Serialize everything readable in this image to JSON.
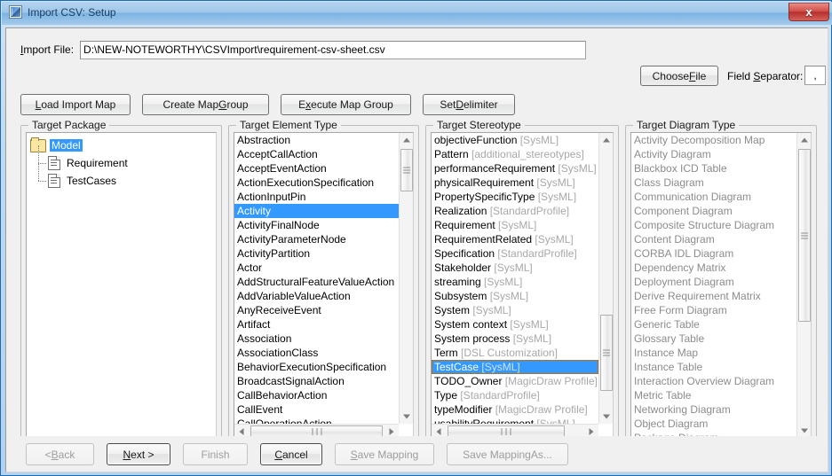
{
  "window": {
    "title": "Import CSV: Setup",
    "app_icon": "csv-app-icon",
    "close_label": "x"
  },
  "toolbar": {
    "import_file_label": "Import File:",
    "import_file_value": "D:\\NEW-NOTEWORTHY\\CSVImport\\requirement-csv-sheet.csv",
    "import_file_placeholder": "",
    "choose_file_label": "Choose File",
    "field_separator_label": "Field Separator:",
    "field_separator_value": ",",
    "buttons": [
      {
        "label": "Load Import Map",
        "enabled": true
      },
      {
        "label": "Create Map Group",
        "enabled": true
      },
      {
        "label": "Execute Map Group",
        "enabled": true
      },
      {
        "label": "Set Delimiter",
        "enabled": true
      }
    ]
  },
  "panels": {
    "target_package": {
      "title": "Target Package",
      "tree": [
        {
          "label": "Model",
          "icon": "folder-icon",
          "level": 0,
          "selected": true
        },
        {
          "label": "Requirement",
          "icon": "document-icon",
          "level": 1,
          "selected": false
        },
        {
          "label": "TestCases",
          "icon": "document-icon",
          "level": 1,
          "selected": false
        }
      ]
    },
    "target_element_type": {
      "title": "Target Element Type",
      "items": [
        {
          "name": "Abstraction"
        },
        {
          "name": "AcceptCallAction"
        },
        {
          "name": "AcceptEventAction"
        },
        {
          "name": "ActionExecutionSpecification"
        },
        {
          "name": "ActionInputPin"
        },
        {
          "name": "Activity",
          "selected": true
        },
        {
          "name": "ActivityFinalNode"
        },
        {
          "name": "ActivityParameterNode"
        },
        {
          "name": "ActivityPartition"
        },
        {
          "name": "Actor"
        },
        {
          "name": "AddStructuralFeatureValueAction"
        },
        {
          "name": "AddVariableValueAction"
        },
        {
          "name": "AnyReceiveEvent"
        },
        {
          "name": "Artifact"
        },
        {
          "name": "Association"
        },
        {
          "name": "AssociationClass"
        },
        {
          "name": "BehaviorExecutionSpecification"
        },
        {
          "name": "BroadcastSignalAction"
        },
        {
          "name": "CallBehaviorAction"
        },
        {
          "name": "CallEvent"
        },
        {
          "name": "CallOperationAction"
        }
      ]
    },
    "target_stereotype": {
      "title": "Target Stereotype",
      "items": [
        {
          "name": "objectiveFunction",
          "profile": "[SysML]"
        },
        {
          "name": "Pattern",
          "profile": "[additional_stereotypes]"
        },
        {
          "name": "performanceRequirement",
          "profile": "[SysML]"
        },
        {
          "name": "physicalRequirement",
          "profile": "[SysML]"
        },
        {
          "name": "PropertySpecificType",
          "profile": "[SysML]"
        },
        {
          "name": "Realization",
          "profile": "[StandardProfile]"
        },
        {
          "name": "Requirement",
          "profile": "[SysML]"
        },
        {
          "name": "RequirementRelated",
          "profile": "[SysML]"
        },
        {
          "name": "Specification",
          "profile": "[StandardProfile]"
        },
        {
          "name": "Stakeholder",
          "profile": "[SysML]"
        },
        {
          "name": "streaming",
          "profile": "[SysML]"
        },
        {
          "name": "Subsystem",
          "profile": "[SysML]"
        },
        {
          "name": "System",
          "profile": "[SysML]"
        },
        {
          "name": "System context",
          "profile": "[SysML]"
        },
        {
          "name": "System process",
          "profile": "[SysML]"
        },
        {
          "name": "Term",
          "profile": "[DSL Customization]"
        },
        {
          "name": "TestCase",
          "profile": "[SysML]",
          "selected": true
        },
        {
          "name": "TODO_Owner",
          "profile": "[MagicDraw Profile]"
        },
        {
          "name": "Type",
          "profile": "[StandardProfile]"
        },
        {
          "name": "typeModifier",
          "profile": "[MagicDraw Profile]"
        },
        {
          "name": "usabilityRequirement",
          "profile": "[SysML]"
        }
      ]
    },
    "target_diagram_type": {
      "title": "Target Diagram Type",
      "enabled": false,
      "items": [
        {
          "name": "Activity Decomposition Map"
        },
        {
          "name": "Activity Diagram"
        },
        {
          "name": "Blackbox ICD Table"
        },
        {
          "name": "Class Diagram"
        },
        {
          "name": "Communication Diagram"
        },
        {
          "name": "Component Diagram"
        },
        {
          "name": "Composite Structure Diagram"
        },
        {
          "name": "Content Diagram"
        },
        {
          "name": "CORBA IDL Diagram"
        },
        {
          "name": "Dependency Matrix"
        },
        {
          "name": "Deployment Diagram"
        },
        {
          "name": "Derive Requirement Matrix"
        },
        {
          "name": "Free Form Diagram"
        },
        {
          "name": "Generic Table"
        },
        {
          "name": "Glossary Table"
        },
        {
          "name": "Instance Map"
        },
        {
          "name": "Instance Table"
        },
        {
          "name": "Interaction Overview Diagram"
        },
        {
          "name": "Metric Table"
        },
        {
          "name": "Networking Diagram"
        },
        {
          "name": "Object Diagram"
        },
        {
          "name": "Package Diagram"
        }
      ]
    }
  },
  "footer": {
    "buttons": [
      {
        "label": "< Back",
        "enabled": false
      },
      {
        "label": "Next >",
        "enabled": true,
        "default": true
      },
      {
        "label": "Finish",
        "enabled": false
      },
      {
        "label": "Cancel",
        "enabled": true,
        "focused": true
      },
      {
        "label": "Save Mapping",
        "enabled": false
      },
      {
        "label": "Save Mapping As...",
        "enabled": false
      }
    ]
  },
  "colors": {
    "selection": "#3399ff",
    "title_bar": "#9ec7ea",
    "window_border": "#1c6bb5",
    "dialog_bg": "#f0f0f0",
    "disabled_text": "#8c8c8c",
    "profile_text": "#a8a8a8",
    "focus_ring": "#c07820"
  }
}
